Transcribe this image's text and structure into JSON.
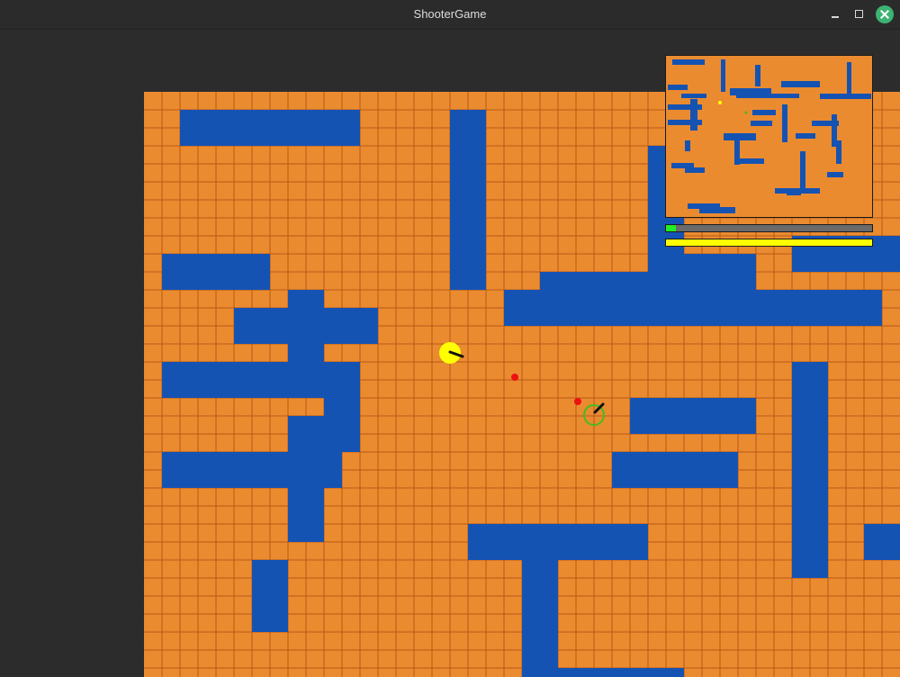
{
  "window": {
    "title": "ShooterGame"
  },
  "colors": {
    "floor": "#ea8b30",
    "grid_line": "#b85818",
    "wall": "#1553b3",
    "background": "#2c2c2c",
    "player": "#ffff00",
    "enemy_ring": "#44bb22",
    "bullet": "#ee1111",
    "ammo_bar_fill": "#22ee22",
    "health_bar_fill": "#ffff00"
  },
  "hud": {
    "ammo_level": 0.05,
    "health_level": 1.0
  }
}
